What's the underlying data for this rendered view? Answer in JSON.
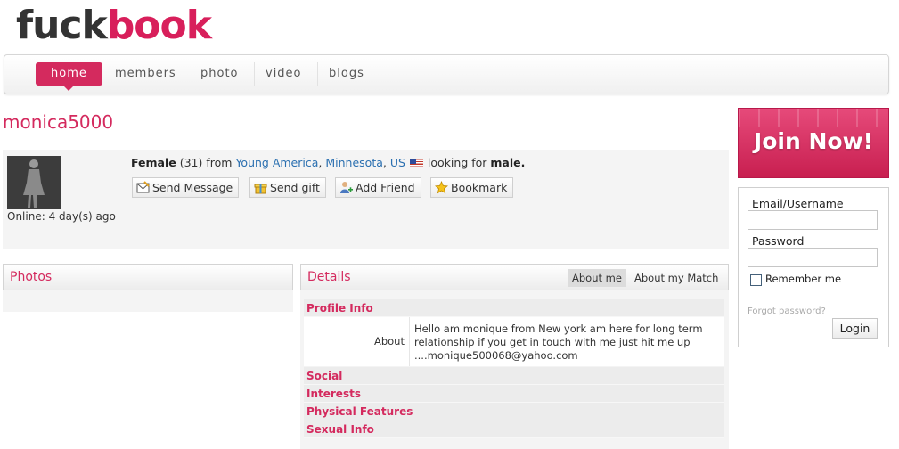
{
  "site": {
    "logo_part1": "fuck",
    "logo_part2": "book",
    "colors": {
      "accent": "#d42a5e",
      "link": "#2a6fb0"
    }
  },
  "nav": {
    "items": [
      {
        "label": "home",
        "active": true
      },
      {
        "label": "members",
        "active": false
      },
      {
        "label": "photo",
        "active": false
      },
      {
        "label": "video",
        "active": false
      },
      {
        "label": "blogs",
        "active": false
      }
    ]
  },
  "profile": {
    "username": "monica5000",
    "gender": "Female",
    "age": "(31)",
    "from_text": "from",
    "city": "Young America",
    "sep1": ",",
    "state": "Minnesota",
    "sep2": ",",
    "country": "US",
    "flag_icon": "us-flag-icon",
    "looking_text": "looking for",
    "looking_for": "male.",
    "online_status": "Online: 4 day(s) ago",
    "actions": [
      {
        "label": "Send Message",
        "icon": "message-icon"
      },
      {
        "label": "Send gift",
        "icon": "gift-icon"
      },
      {
        "label": "Add Friend",
        "icon": "add-friend-icon"
      },
      {
        "label": "Bookmark",
        "icon": "star-icon"
      }
    ]
  },
  "photos": {
    "title": "Photos"
  },
  "details": {
    "title": "Details",
    "tabs": [
      {
        "label": "About me",
        "active": true
      },
      {
        "label": "About my Match",
        "active": false
      }
    ],
    "sections": [
      "Profile Info",
      "Social",
      "Interests",
      "Physical Features",
      "Sexual Info"
    ],
    "about_label": "About",
    "about_text": "Hello am monique from New york am here for long term relationship if you get in touch with me just hit me up ....monique500068@yahoo.com"
  },
  "sidebar": {
    "join_label": "Join Now!",
    "email_label": "Email/Username",
    "email_value": "",
    "password_label": "Password",
    "password_value": "",
    "remember_label": "Remember me",
    "remember_checked": false,
    "forgot_label": "Forgot password?",
    "login_label": "Login"
  }
}
